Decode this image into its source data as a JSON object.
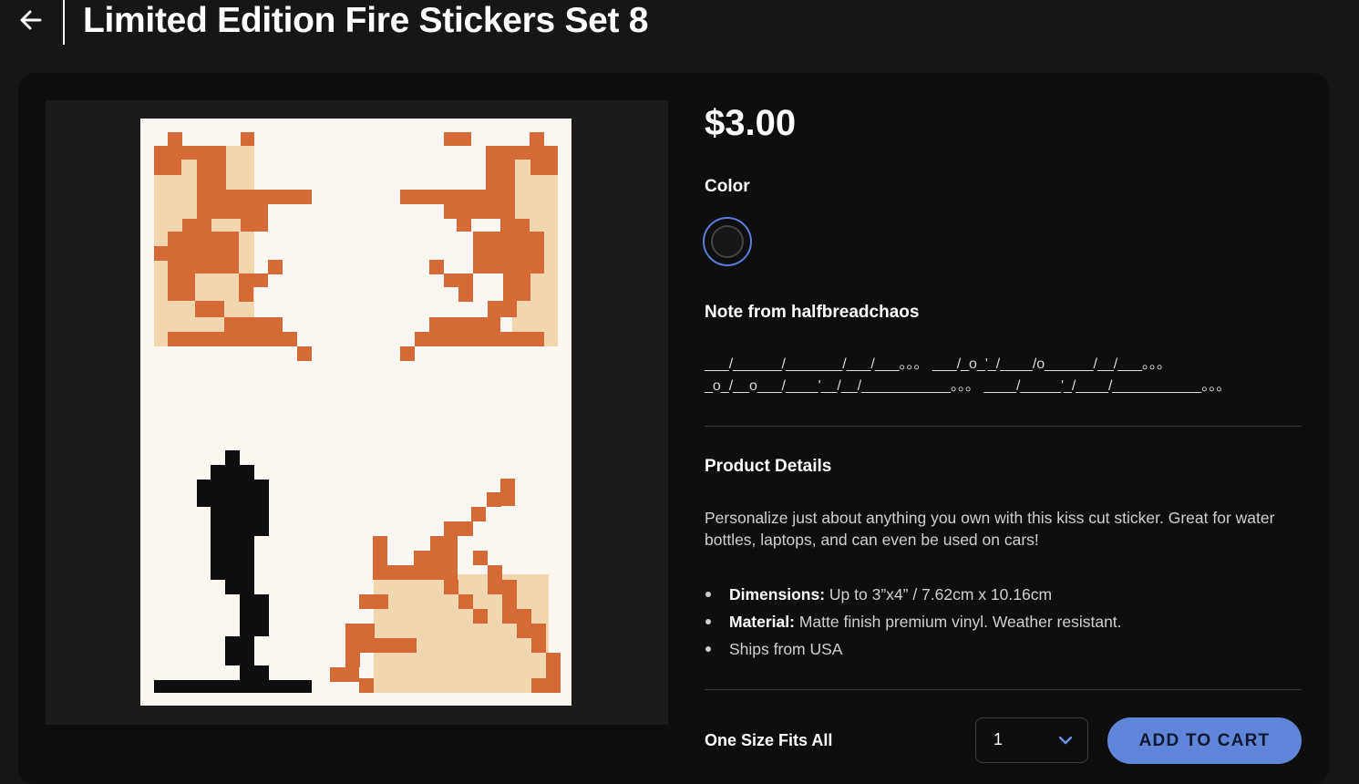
{
  "header": {
    "title": "Limited Edition Fire Stickers Set 8"
  },
  "product": {
    "price": "$3.00",
    "color_label": "Color",
    "selected_color": "#161616",
    "note_label": "Note from halfbreadchaos",
    "note_lines": [
      "___/______/_______/___/___。。。 ___/_o_'_/____/o______/__/___。。。",
      "_o_/__o___/____'__/__/___________。。。 ____/_____'_/____/___________。。。"
    ],
    "details_label": "Product Details",
    "description": "Personalize just about anything you own with this kiss cut sticker. Great for water bottles, laptops, and can even be used on cars!",
    "bullets": [
      {
        "key": "Dimensions:",
        "value": "Up to 3”x4” / 7.62cm x 10.16cm"
      },
      {
        "key": "Material:",
        "value": "Matte finish premium vinyl. Weather resistant."
      },
      {
        "key": "",
        "value": "Ships from USA"
      }
    ],
    "size_label": "One Size Fits All",
    "quantity": "1",
    "add_to_cart_label": "ADD TO CART"
  },
  "colors": {
    "accent": "#5f86d9",
    "fire_dark": "#d56a36",
    "fire_light": "#f2d7ae",
    "paper": "#fcf8f1"
  }
}
